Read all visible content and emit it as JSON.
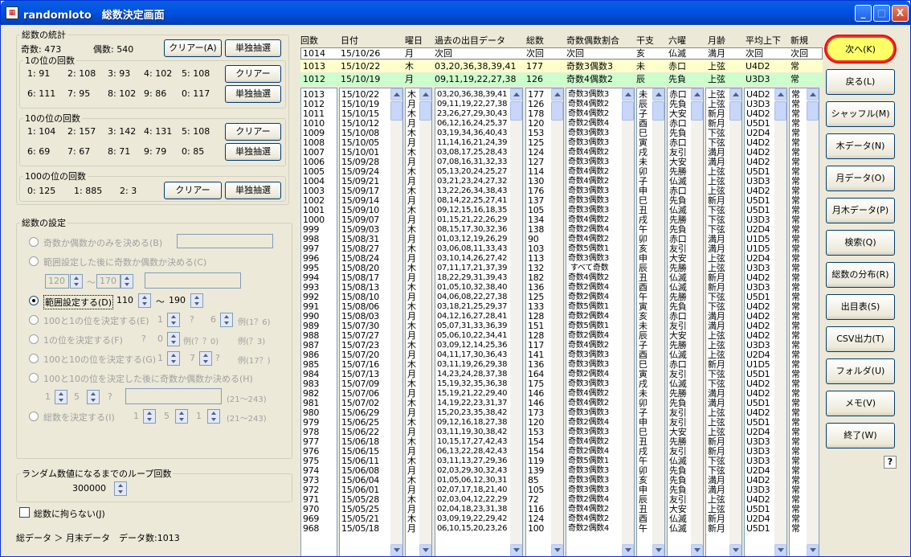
{
  "window": {
    "title": "randomloto　総数決定画面",
    "min_label": "_",
    "max_label": "□",
    "close_label": "X"
  },
  "stats": {
    "legend": "総数の統計",
    "odd_label": "奇数: 473",
    "even_label": "偶数: 540",
    "clear_btn": "クリアー(A)",
    "single_btn": "単独抽選",
    "ones_legend": "1の位の回数",
    "ones_row1": [
      "1: 91",
      "2: 108",
      "3: 93",
      "4: 102",
      "5: 108"
    ],
    "ones_row2": [
      "6: 111",
      "7: 95",
      "8: 102",
      "9: 86",
      "0: 117"
    ],
    "tens_legend": "10の位の回数",
    "tens_row1": [
      "1: 104",
      "2: 157",
      "3: 142",
      "4: 131",
      "5: 108"
    ],
    "tens_row2": [
      "6: 69",
      "7: 67",
      "8: 71",
      "9: 79",
      "0: 85"
    ],
    "hund_legend": "100の位の回数",
    "hund_row": [
      "0: 125",
      "1: 885",
      "2: 3"
    ],
    "clear_label": "クリアー",
    "single_label": "単独抽選"
  },
  "settings": {
    "legend": "総数の設定",
    "opt1": "奇数か偶数かのみを決める(B)",
    "opt2": "範囲設定した後に奇数か偶数か決める(C)",
    "opt2_from": "120",
    "opt2_to": "170",
    "tilde": "～",
    "opt3": "範囲設定する(D)",
    "opt3_from": "110",
    "opt3_to": "190",
    "opt4": "100と1の位を決定する(E)",
    "opt4_a": "1",
    "opt4_b": "?",
    "opt4_c": "6",
    "opt4_ex": "例(1？6)",
    "opt5": "1の位を決定する(F)",
    "opt5_a": "?",
    "opt5_b": "0",
    "opt5_ex1": "例(？？0)",
    "opt5_ex2": "例(？3)",
    "opt6": "100と10の位を決定する(G)",
    "opt6_a": "1",
    "opt6_b": "7",
    "opt6_c": "?",
    "opt6_ex": "例(17？)",
    "opt7": "100と10の位を決定した後に奇数か偶数か決める(H)",
    "opt7_a": "1",
    "opt7_b": "5",
    "opt7_c": "?",
    "opt7_range": "(21～243)",
    "opt8": "総数を決定する(I)",
    "opt8_a": "1",
    "opt8_b": "5",
    "opt8_c": "1",
    "opt8_range": "(21～243)"
  },
  "loop": {
    "legend": "ランダム数値になるまでのループ回数",
    "value": "300000"
  },
  "no_total": {
    "label": "総数に拘らない(J)"
  },
  "status": {
    "text": "総データ ＞ 月末データ　データ数:1013"
  },
  "table": {
    "headers": [
      "回数",
      "日付",
      "曜日",
      "過去の出目データ",
      "総数",
      "奇数偶数割合",
      "干支",
      "六曜",
      "月齢",
      "平均上下",
      "新規"
    ],
    "row_next": [
      "1014",
      "15/10/26",
      "月",
      "次回",
      "次回",
      "次回",
      "亥",
      "仏滅",
      "満月",
      "次回",
      "次回"
    ],
    "row_yellow": [
      "1013",
      "15/10/22",
      "木",
      "03,20,36,38,39,41",
      "177",
      "奇数3偶数3",
      "未",
      "赤口",
      "上弦",
      "U4D2",
      "常"
    ],
    "row_green": [
      "1012",
      "15/10/19",
      "月",
      "09,11,19,22,27,38",
      "126",
      "奇数4偶数2",
      "辰",
      "先負",
      "上弦",
      "U3D3",
      "常"
    ]
  },
  "lists": {
    "kai": "1013\n1012\n1011\n1010\n1009\n1008\n1007\n1006\n1005\n1004\n1003\n1002\n1001\n1000\n999\n998\n997\n996\n995\n994\n993\n992\n991\n990\n989\n988\n987\n986\n985\n984\n983\n982\n981\n980\n979\n978\n977\n976\n975\n974\n973\n972\n971\n970\n969\n968",
    "date": "15/10/22\n15/10/19\n15/10/15\n15/10/12\n15/10/08\n15/10/05\n15/10/01\n15/09/28\n15/09/24\n15/09/21\n15/09/17\n15/09/14\n15/09/10\n15/09/07\n15/09/03\n15/08/31\n15/08/27\n15/08/24\n15/08/20\n15/08/17\n15/08/13\n15/08/10\n15/08/06\n15/08/03\n15/07/30\n15/07/27\n15/07/23\n15/07/20\n15/07/16\n15/07/13\n15/07/09\n15/07/06\n15/07/02\n15/06/29\n15/06/25\n15/06/22\n15/06/18\n15/06/15\n15/06/11\n15/06/08\n15/06/04\n15/06/01\n15/05/28\n15/05/25\n15/05/21\n15/05/18",
    "youbi": "木\n月\n木\n月\n木\n月\n木\n月\n木\n月\n木\n月\n木\n月\n木\n月\n木\n月\n木\n月\n木\n月\n木\n月\n木\n月\n木\n月\n木\n月\n木\n月\n木\n月\n木\n月\n木\n月\n木\n月\n木\n月\n木\n月\n木\n月",
    "deme": "03,20,36,38,39,41\n09,11,19,22,27,38\n23,26,27,29,30,43\n06,12,16,24,25,37\n03,19,34,36,40,43\n11,14,16,21,24,39\n03,08,17,25,28,43\n07,08,16,31,32,33\n05,13,20,24,25,27\n03,21,23,24,27,32\n13,22,26,34,38,43\n08,14,22,25,27,41\n09,12,15,16,18,35\n01,15,21,22,26,29\n08,15,17,30,32,36\n01,03,12,19,26,29\n03,06,08,11,33,43\n03,10,14,26,27,42\n07,11,17,21,37,39\n18,22,29,31,39,43\n01,05,10,32,38,40\n04,06,08,22,27,38\n03,18,21,25,29,37\n04,12,16,27,28,41\n05,07,31,33,36,39\n05,06,10,22,34,41\n03,09,12,14,25,36\n04,11,17,30,36,43\n03,11,19,26,29,38\n14,23,24,28,37,38\n15,19,32,35,36,38\n15,19,21,22,29,40\n14,19,22,23,31,37\n15,20,23,35,38,42\n09,12,16,18,27,38\n03,11,19,30,38,42\n10,15,17,27,42,43\n06,13,22,28,42,43\n03,11,13,27,29,36\n02,03,29,30,32,43\n01,05,06,12,30,31\n02,07,17,18,21,40\n02,03,04,12,22,29\n02,04,18,23,31,38\n03,09,19,22,29,42\n06,10,15,20,23,26",
    "total": "177\n126\n178\n120\n153\n125\n124\n127\n114\n130\n176\n137\n105\n134\n138\n90\n103\n113\n132\n182\n136\n125\n133\n128\n151\n128\n117\n141\n136\n164\n175\n146\n146\n173\n120\n153\n154\n154\n119\n139\n85\n105\n72\n116\n124\n100",
    "ratio": "奇数3偶数3\n奇数4偶数2\n奇数4偶数2\n奇数2偶数4\n奇数3偶数3\n奇数3偶数3\n奇数4偶数2\n奇数3偶数3\n奇数4偶数2\n奇数4偶数2\n奇数3偶数3\n奇数3偶数3\n奇数3偶数3\n奇数4偶数2\n奇数2偶数4\n奇数4偶数2\n奇数5偶数1\n奇数3偶数3\n すべて奇数\n奇数4偶数2\n奇数2偶数4\n奇数2偶数4\n奇数5偶数1\n奇数2偶数4\n奇数5偶数1\n奇数2偶数4\n奇数4偶数2\n奇数3偶数3\n奇数3偶数3\n奇数2偶数4\n奇数3偶数3\n奇数4偶数2\n奇数4偶数2\n奇数3偶数3\n奇数2偶数4\n奇数3偶数3\n奇数4偶数2\n奇数2偶数4\n奇数5偶数1\n奇数3偶数3\n奇数3偶数3\n奇数3偶数3\n奇数2偶数4\n奇数4偶数2\n奇数4偶数2\n奇数2偶数4",
    "eto": "未\n辰\n子\n酉\n巳\n寅\n戌\n未\n卯\n子\n申\n巳\n丑\n戌\n午\n卯\n亥\n申\n辰\n丑\n酉\n午\n寅\n亥\n未\n辰\n子\n酉\n巳\n寅\n戌\n未\n卯\n子\n申\n巳\n丑\n戌\n午\n卯\n亥\n申\n辰\n丑\n酉\n午",
    "rokuyo": "赤口\n先負\n大安\n赤口\n先負\n赤口\n友引\n大安\n先勝\n仏滅\n赤口\n先負\n仏滅\n先勝\n先負\n赤口\n友引\n大安\n先勝\n仏滅\n仏滅\n先勝\n先負\n赤口\n友引\n大安\n先勝\n仏滅\n赤口\n友引\n仏滅\n先勝\n先負\n友引\n友引\n大安\n先勝\n友引\n仏滅\n先負\n先負\n先負\n友引\n大安\n仏滅\n仏滅",
    "getsurei": "上弦\n上弦\n新月\n新月\n下弦\n下弦\n満月\n満月\n上弦\n上弦\n上弦\n新月\n下弦\n下弦\n下弦\n満月\n満月\n上弦\n上弦\n新月\n新月\n下弦\n下弦\n満月\n満月\n上弦\n上弦\n上弦\n新月\n下弦\n下弦\n満月\n満月\n上弦\n上弦\n上弦\n新月\n新月\n下弦\n下弦\n満月\n満月\n上弦\n上弦\n新月\n新月",
    "heikin": "U4D2\nU3D3\nU4D2\nU5D1\nU2D4\nU4D2\nU4D2\nU4D2\nU5D1\nU3D3\nU4D2\nU5D1\nU5D1\nU3D3\nU2D4\nU1D5\nU1D5\nU2D4\nU3D3\nU4D2\nU3D3\nU5D1\nU4D2\nU4D2\nU4D2\nU4D2\nU3D3\nU2D4\nU1D5\nU5D1\nU4D2\nU4D2\nU5D1\nU4D2\nU5D1\nU2D4\nU3D3\nU3D3\nU3D3\nU2D4\nU4D2\nU3D3\nU4D2\nU5D1\nU2D4\nU5D1",
    "shinki": "常\n常\n常\n常\n常\n常\n常\n常\n常\n常\n常\n常\n常\n常\n常\n常\n常\n常\n常\n常\n常\n常\n常\n常\n常\n常\n常\n常\n常\n常\n常\n常\n常\n常\n常\n常\n常\n常\n常\n常\n常\n常\n常\n常\n常\n常"
  },
  "side": {
    "next": "次へ(K)",
    "back": "戻る(L)",
    "shuffle": "シャッフル(M)",
    "thu": "木データ(N)",
    "mon": "月データ(O)",
    "monthu": "月木データ(P)",
    "search": "検索(Q)",
    "dist": "総数の分布(R)",
    "chart": "出目表(S)",
    "csv": "CSV出力(T)",
    "folder": "フォルダ(U)",
    "memo": "メモ(V)",
    "exit": "終了(W)",
    "help": "?"
  },
  "colors": {
    "yellow_row": "#ffffcc",
    "green_row": "#ccffcc",
    "next_btn": "#ffff66",
    "highlight": "#ff0000"
  }
}
